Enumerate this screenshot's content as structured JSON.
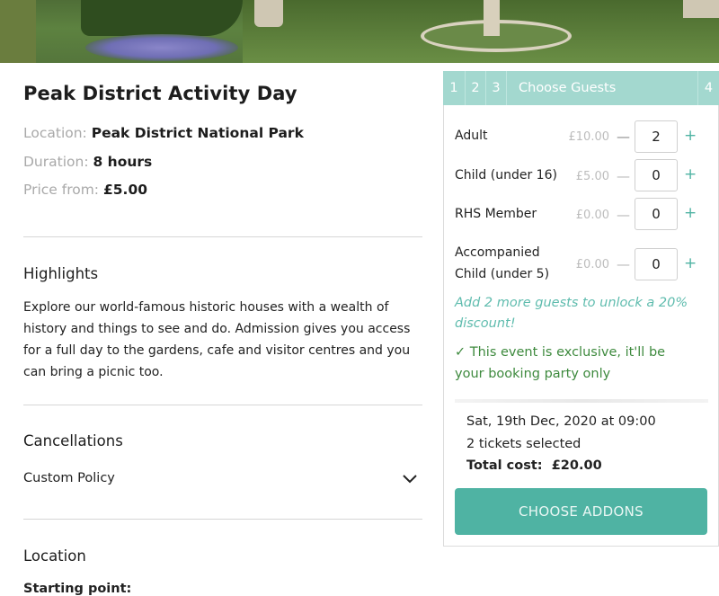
{
  "event": {
    "title": "Peak District Activity Day",
    "location_label": "Location:",
    "location_value": "Peak District National Park",
    "duration_label": "Duration:",
    "duration_value": "8 hours",
    "price_label": "Price from:",
    "price_value": "£5.00"
  },
  "highlights": {
    "heading": "Highlights",
    "text": "Explore our world-famous historic houses with a wealth of history and things to see and do. Admission gives you access for a full day to the gardens, cafe and visitor centres and you can bring a picnic too."
  },
  "cancellations": {
    "heading": "Cancellations",
    "policy": "Custom Policy"
  },
  "location_section": {
    "heading": "Location",
    "starting_point": "Starting point:"
  },
  "booking": {
    "steps": [
      "1",
      "2",
      "3",
      "Choose Guests",
      "4"
    ],
    "guests": [
      {
        "label": "Adult",
        "price": "£10.00",
        "qty": "2"
      },
      {
        "label": "Child (under 16)",
        "price": "£5.00",
        "qty": "0"
      },
      {
        "label": "RHS Member",
        "price": "£0.00",
        "qty": "0"
      },
      {
        "label_line1": "Accompanied",
        "label_line2": "Child (under 5)",
        "price": "£0.00",
        "qty": "0"
      }
    ],
    "minus_symbol": "—",
    "plus_symbol": "+",
    "promo": "Add 2 more guests to unlock a 20% discount!",
    "exclusive": "✓ This event is exclusive, it'll be your booking party only",
    "date": "Sat, 19th Dec, 2020 at 09:00",
    "tickets": "2 tickets selected",
    "total_label": "Total cost:",
    "total_value": "£20.00",
    "button": "CHOOSE ADDONS"
  },
  "colors": {
    "accent": "#4fb3a3",
    "steps_bar": "#a3d8cf",
    "exclusive_text": "#3e8a3e"
  }
}
